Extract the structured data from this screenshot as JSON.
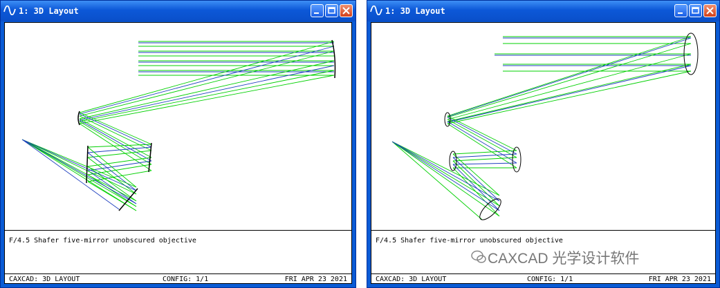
{
  "windows": [
    {
      "title": "1: 3D Layout",
      "description": "F/4.5 Shafer five-mirror unobscured objective",
      "status": {
        "left": "CAXCAD: 3D LAYOUT",
        "center": "CONFIG: 1/1",
        "right": "FRI APR 23 2021"
      }
    },
    {
      "title": "1: 3D Layout",
      "description": "F/4.5 Shafer five-mirror unobscured objective",
      "status": {
        "left": "CAXCAD: 3D LAYOUT",
        "center": "CONFIG: 1/1",
        "right": "FRI APR 23 2021"
      }
    }
  ],
  "watermark": {
    "text": "CAXCAD 光学设计软件",
    "icon": "wechat-icon"
  },
  "colors": {
    "titlebar": "#0a5bd5",
    "ray_green": "#00e000",
    "ray_blue": "#1f3fbf",
    "mirror": "#000000"
  }
}
